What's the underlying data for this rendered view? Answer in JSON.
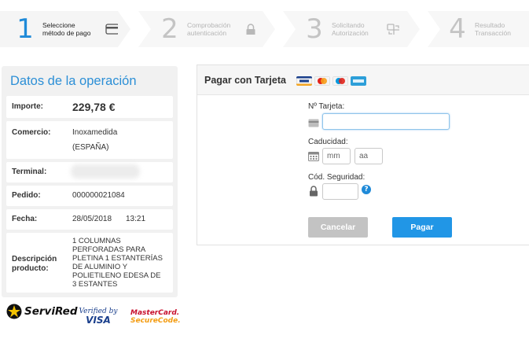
{
  "steps": [
    {
      "number": "1",
      "line1": "Seleccione",
      "line2": "método de pago",
      "icon": "card-icon",
      "state": "active"
    },
    {
      "number": "2",
      "line1": "Comprobación",
      "line2": "autenticación",
      "icon": "lock-icon",
      "state": "inactive"
    },
    {
      "number": "3",
      "line1": "Solicitando",
      "line2": "Autorización",
      "icon": "transfer-icon",
      "state": "inactive"
    },
    {
      "number": "4",
      "line1": "Resultado",
      "line2": "Transacción",
      "icon": "none",
      "state": "inactive"
    }
  ],
  "operation": {
    "title": "Datos de la operación",
    "importe_label": "Importe:",
    "importe_value": "229,78 €",
    "comercio_label": "Comercio:",
    "comercio_name": "Inoxamedida",
    "comercio_country": "(ESPAÑA)",
    "terminal_label": "Terminal:",
    "pedido_label": "Pedido:",
    "pedido_value": "000000021084",
    "fecha_label": "Fecha:",
    "fecha_date": "28/05/2018",
    "fecha_time": "13:21",
    "descripcion_label_1": "Descripción",
    "descripcion_label_2": "producto:",
    "descripcion_lines": [
      "1 COLUMNAS",
      "PERFORADAS PARA",
      "PLETINA 1 ESTANTERÍAS",
      "DE ALUMINIO Y",
      "POLIETILENO EDESA DE",
      "3 ESTANTES"
    ]
  },
  "logos": {
    "servired": "ServiRed",
    "verified_1": "Verified by",
    "verified_2": "VISA",
    "mastercard_1": "MasterCard.",
    "mastercard_2": "SecureCode."
  },
  "payment": {
    "title": "Pagar con Tarjeta",
    "card_label": "Nº Tarjeta:",
    "expiry_label": "Caducidad:",
    "month_placeholder": "mm",
    "year_placeholder": "aa",
    "cvv_label": "Cód. Seguridad:",
    "help": "?",
    "cancel_label": "Cancelar",
    "pay_label": "Pagar"
  },
  "colors": {
    "accent": "#1f8ad8",
    "pay_button": "#2196e6",
    "cancel_button": "#c3c3c3",
    "left_panel_bg": "#f1f1f1"
  }
}
